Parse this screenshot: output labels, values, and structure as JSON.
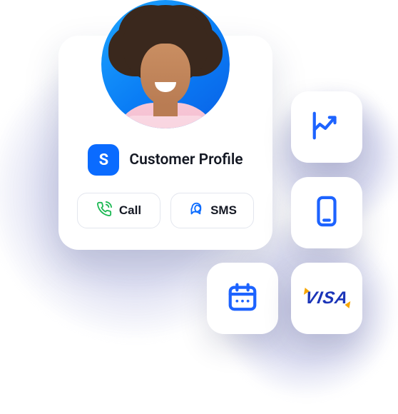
{
  "profile": {
    "badge_letter": "S",
    "title": "Customer Profile"
  },
  "actions": {
    "call_label": "Call",
    "sms_label": "SMS"
  },
  "tiles": {
    "visa_label": "VISA"
  },
  "icons": {
    "chart": "chart-up-icon",
    "mobile": "mobile-icon",
    "calendar": "calendar-icon",
    "visa": "visa-logo",
    "phone": "phone-icon",
    "sms": "chat-icon",
    "badge": "s-badge-icon"
  },
  "colors": {
    "accent": "#0a6bff",
    "call_icon": "#1db954",
    "sms_icon": "#0a6bff",
    "tile_icon": "#1d63ff",
    "visa_blue": "#1a34b8",
    "visa_orange": "#f7a600"
  }
}
